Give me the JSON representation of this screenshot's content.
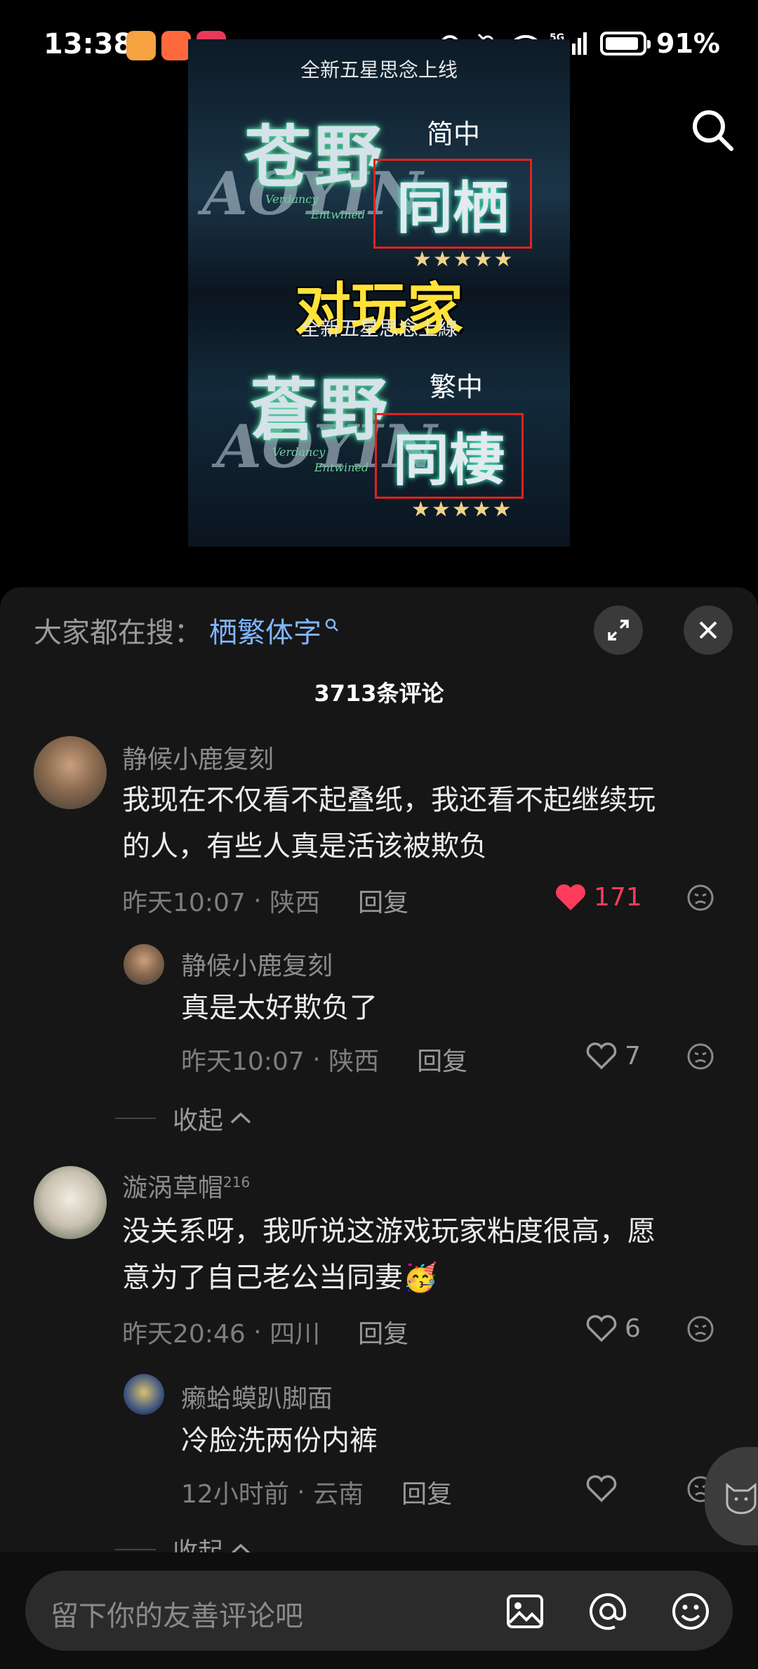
{
  "status": {
    "time": "13:38",
    "battery": "91%",
    "battery_level": 0.91,
    "network": "5G"
  },
  "poster": {
    "top_banner": "全新五星思念上线",
    "label_simplified": "简中",
    "title_simplified": "苍野",
    "boxed_simplified": "同栖",
    "overlay": "对玩家",
    "bottom_banner": "全新五星思念上線",
    "label_traditional": "繁中",
    "title_traditional": "蒼野",
    "boxed_traditional": "同棲",
    "english_title": "AOYIN",
    "english_sub_1": "Verdancy",
    "english_sub_2": "Entwined",
    "stars": "★★★★★"
  },
  "hot_search": {
    "prefix": "大家都在搜：",
    "term": "栖繁体字"
  },
  "comment_count": "3713条评论",
  "comments": [
    {
      "user": "静候小鹿复刻",
      "text_line1": "我现在不仅看不起叠纸，我还看不起继续玩",
      "text_line2": "的人，有些人真是活该被欺负",
      "time": "昨天10:07",
      "location": "陕西",
      "reply_label": "回复",
      "likes": "171",
      "liked": true
    },
    {
      "user": "静候小鹿复刻",
      "text_line1": "真是太好欺负了",
      "time": "昨天10:07",
      "location": "陕西",
      "reply_label": "回复",
      "likes": "7",
      "liked": false
    },
    {
      "user": "漩涡草帽",
      "badge": "216",
      "text_line1": "没关系呀，我听说这游戏玩家粘度很高，愿",
      "text_line2": "意为了自己老公当同妻🥳",
      "time": "昨天20:46",
      "location": "四川",
      "reply_label": "回复",
      "likes": "6",
      "liked": false
    },
    {
      "user": "癞蛤蟆趴脚面",
      "text_line1": "冷脸洗两份内裤",
      "time": "12小时前",
      "location": "云南",
      "reply_label": "回复",
      "likes": "",
      "liked": false
    }
  ],
  "collapse_label": "收起",
  "input": {
    "placeholder": "留下你的友善评论吧"
  },
  "colors": {
    "accent_like": "#ff3b5c",
    "link_blue": "#7fb7ff",
    "sheet_bg": "#161616"
  }
}
